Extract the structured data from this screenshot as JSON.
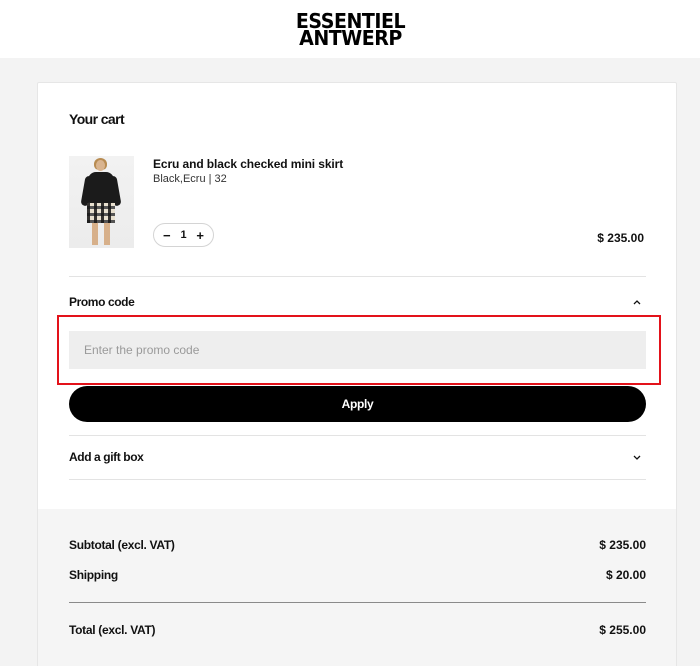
{
  "header": {
    "logo_line1": "ESSENTIEL",
    "logo_line2": "ANTWERP"
  },
  "cart": {
    "title": "Your cart",
    "item": {
      "name": "Ecru and black checked mini skirt",
      "variant": "Black,Ecru | 32",
      "quantity": "1",
      "decrement_icon": "minus-icon",
      "increment_icon": "plus-icon",
      "decrement_label": "−",
      "increment_label": "+",
      "price": "$ 235.00"
    }
  },
  "promo": {
    "label": "Promo code",
    "toggle_icon": "chevron-up-icon",
    "input_placeholder": "Enter the promo code",
    "input_value": "",
    "apply_label": "Apply"
  },
  "gift": {
    "label": "Add a gift box",
    "toggle_icon": "chevron-down-icon"
  },
  "summary": {
    "subtotal_label": "Subtotal (excl. VAT)",
    "subtotal_value": "$ 235.00",
    "shipping_label": "Shipping",
    "shipping_value": "$ 20.00",
    "total_label": "Total (excl. VAT)",
    "total_value": "$ 255.00"
  },
  "colors": {
    "accent": "#000000",
    "highlight": "#e3121a",
    "input_bg": "#eeeeee",
    "page_bg": "#f3f3f3"
  }
}
